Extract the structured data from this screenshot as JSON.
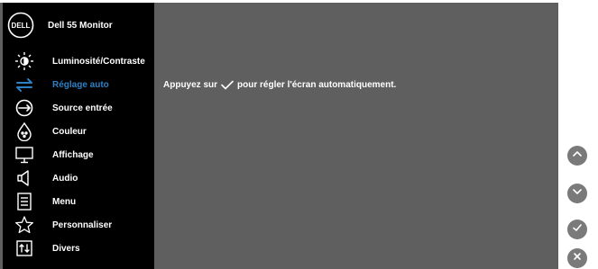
{
  "header": {
    "title": "Dell 55 Monitor",
    "logo_icon": "dell-logo"
  },
  "menu": {
    "items": [
      {
        "label": "Luminosité/Contraste",
        "icon": "brightness-icon"
      },
      {
        "label": "Réglage auto",
        "icon": "auto-adjust-icon",
        "active": true
      },
      {
        "label": "Source entrée",
        "icon": "input-source-icon"
      },
      {
        "label": "Couleur",
        "icon": "color-icon"
      },
      {
        "label": "Affichage",
        "icon": "display-icon"
      },
      {
        "label": "Audio",
        "icon": "speaker-icon"
      },
      {
        "label": "Menu",
        "icon": "menu-document-icon"
      },
      {
        "label": "Personnaliser",
        "icon": "star-icon"
      },
      {
        "label": "Divers",
        "icon": "others-icon"
      }
    ]
  },
  "content": {
    "before": "Appuyez sur",
    "after": "pour régler l'écran automatiquement.",
    "icon": "check-icon"
  },
  "buttons": [
    {
      "icon": "chevron-up-icon"
    },
    {
      "icon": "chevron-down-icon"
    },
    {
      "icon": "check-icon"
    },
    {
      "icon": "close-icon"
    }
  ],
  "colors": {
    "background": "#5f5f5f",
    "sidebar": "#000000",
    "active": "#2e80c5",
    "button": "#7a7a7a",
    "text": "#ffffff"
  }
}
